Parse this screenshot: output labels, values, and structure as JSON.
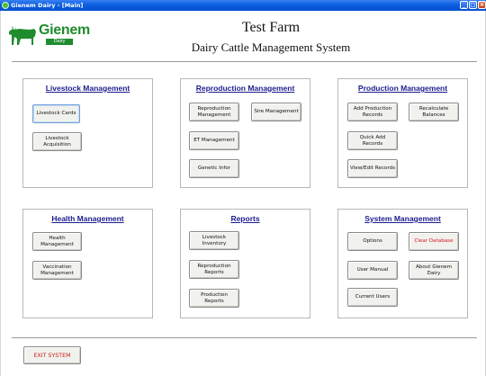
{
  "window": {
    "title": "Gienem Dairy - [Main]"
  },
  "logo": {
    "word": "Gienem",
    "sub": "Dairy"
  },
  "header": {
    "farm_name": "Test Farm",
    "system_name": "Dairy Cattle Management System"
  },
  "panels": {
    "livestock": {
      "title": "Livestock Management",
      "buttons": {
        "cards": "Livestock Cards",
        "acquisition": "Livestock Acquisition"
      }
    },
    "reproduction": {
      "title": "Reproduction Management",
      "buttons": {
        "repro": "Reproduction Management",
        "sire": "Sire Management",
        "et": "ET Management",
        "genetic": "Genetic Infor"
      }
    },
    "production": {
      "title": "Production Management",
      "buttons": {
        "add": "Add Production Records",
        "recalc": "Recalculate Balances",
        "quick": "Quick Add Records",
        "view": "View/Edit Records"
      }
    },
    "health": {
      "title": "Health Management",
      "buttons": {
        "health": "Health Management",
        "vaccination": "Vaccination Management"
      }
    },
    "reports": {
      "title": "Reports",
      "buttons": {
        "inventory": "Livestock Inventory",
        "repro": "Reproduction Reports",
        "production": "Production Reports"
      }
    },
    "system": {
      "title": "System Management",
      "buttons": {
        "options": "Options",
        "clear": "Clear Database",
        "manual": "User Manual",
        "about": "About Gienem Dairy",
        "users": "Current Users"
      }
    }
  },
  "footer": {
    "exit": "EXIT SYSTEM"
  },
  "colors": {
    "panel_title": "#1c1c8e",
    "danger": "#d41a1a",
    "brand_green": "#1f8c2e",
    "titlebar": "#0a5fe0"
  }
}
